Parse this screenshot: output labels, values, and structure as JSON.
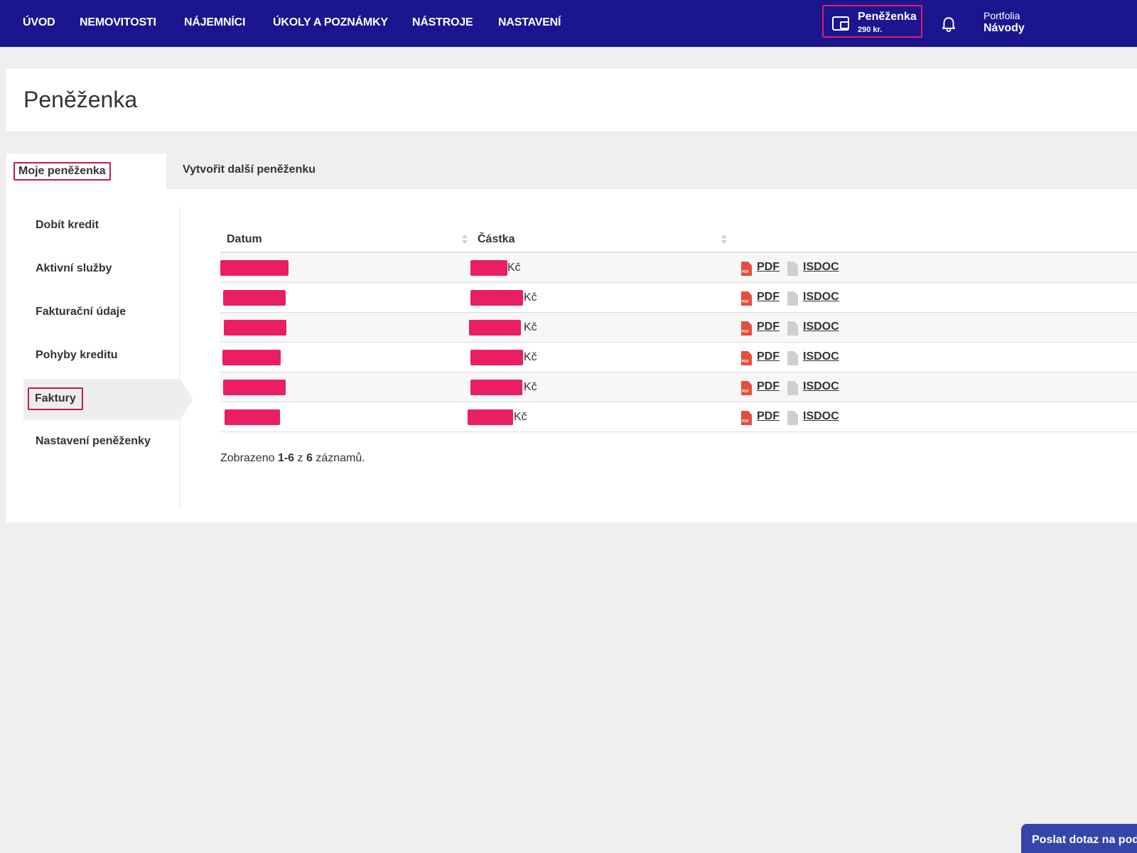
{
  "nav": {
    "items": [
      "ÚVOD",
      "NEMOVITOSTI",
      "NÁJEMNÍCI",
      "ÚKOLY A POZNÁMKY",
      "NÁSTROJE",
      "NASTAVENÍ"
    ]
  },
  "wallet": {
    "title": "Peněženka",
    "balance": "290 kr.",
    "icon": "wallet-icon"
  },
  "notifications": {
    "icon": "bell-icon"
  },
  "user": {
    "top": "Portfolia",
    "bottom": "Návody"
  },
  "page": {
    "title": "Peněženka"
  },
  "tabs": [
    {
      "label": "Moje peněženka",
      "active": true
    },
    {
      "label": "Vytvořit další peněženku",
      "active": false
    }
  ],
  "sidebar": {
    "items": [
      {
        "label": "Dobít kredit",
        "active": false
      },
      {
        "label": "Aktivní služby",
        "active": false
      },
      {
        "label": "Fakturační údaje",
        "active": false
      },
      {
        "label": "Pohyby kreditu",
        "active": false
      },
      {
        "label": "Faktury",
        "active": true
      },
      {
        "label": "Nastavení peněženky",
        "active": false
      }
    ]
  },
  "table": {
    "columns": [
      "Datum",
      "Částka",
      ""
    ],
    "rows": [
      {
        "currency": "Kč",
        "pdf": "PDF",
        "isdoc": "ISDOC"
      },
      {
        "currency": "Kč",
        "pdf": "PDF",
        "isdoc": "ISDOC"
      },
      {
        "currency": "Kč",
        "pdf": "PDF",
        "isdoc": "ISDOC"
      },
      {
        "currency": "Kč",
        "pdf": "PDF",
        "isdoc": "ISDOC"
      },
      {
        "currency": "Kč",
        "pdf": "PDF",
        "isdoc": "ISDOC"
      },
      {
        "currency": "Kč",
        "pdf": "PDF",
        "isdoc": "ISDOC"
      }
    ]
  },
  "pagination": {
    "prefix": "Zobrazeno",
    "range": "1-6",
    "of": "z",
    "total": "6",
    "suffix": "záznamů."
  },
  "support": {
    "label": "Poslat dotaz na podporu"
  },
  "colors": {
    "navbar": "#1b168f",
    "accent": "#e21b64",
    "redaction": "#e91e63",
    "support": "#3545a8"
  }
}
